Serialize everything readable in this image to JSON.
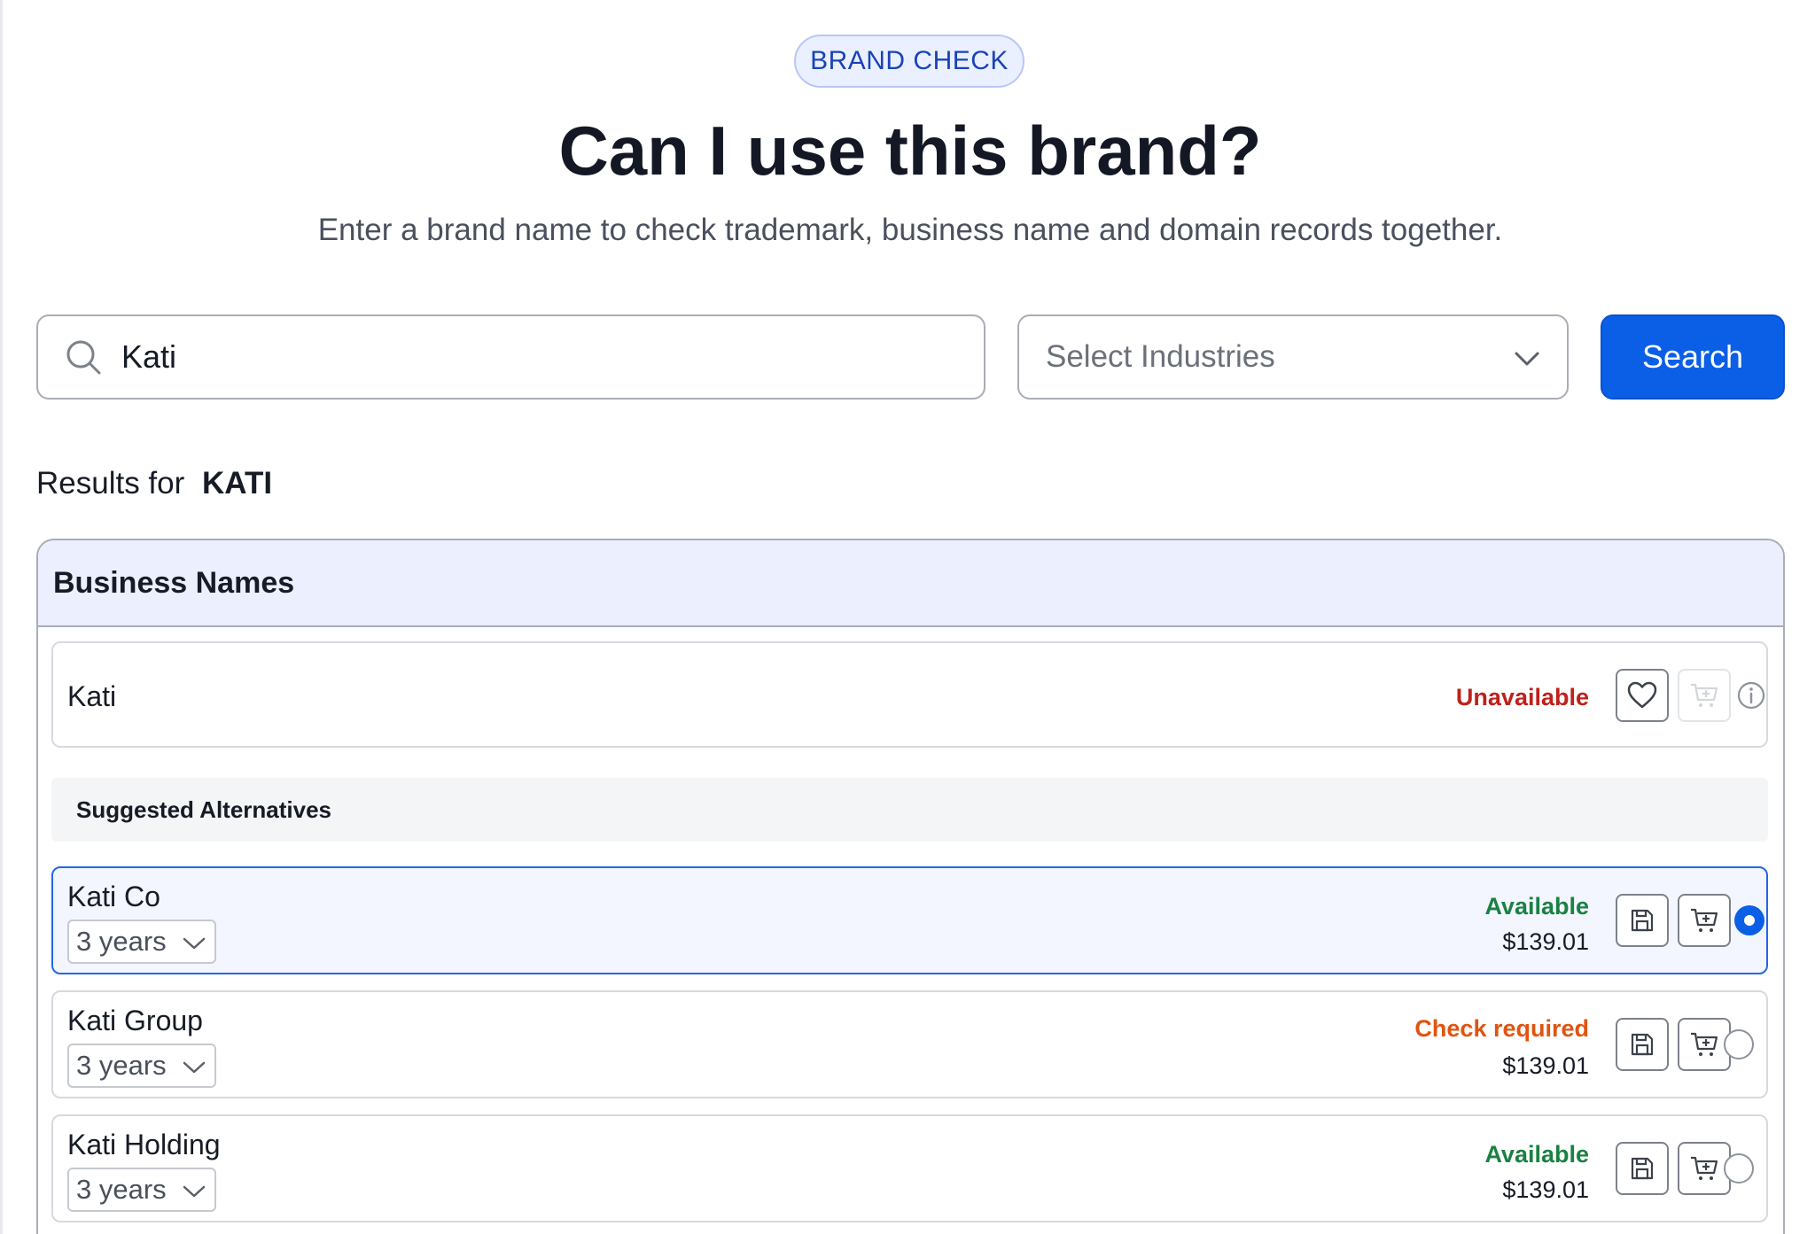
{
  "badge": "BRAND CHECK",
  "title": "Can I use this brand?",
  "subtitle": "Enter a brand name to check trademark, business name and domain records together.",
  "search": {
    "value": "Kati",
    "industries_placeholder": "Select Industries",
    "button_label": "Search"
  },
  "results": {
    "prefix": "Results for",
    "query": "KATI"
  },
  "panel": {
    "title": "Business Names",
    "primary": {
      "name": "Kati",
      "status": "Unavailable"
    },
    "alternatives_label": "Suggested Alternatives",
    "alternatives": [
      {
        "name": "Kati Co",
        "term": "3 years",
        "status": "Available",
        "price": "$139.01",
        "selected": true
      },
      {
        "name": "Kati Group",
        "term": "3 years",
        "status": "Check required",
        "price": "$139.01",
        "selected": false
      },
      {
        "name": "Kati Holding",
        "term": "3 years",
        "status": "Available",
        "price": "$139.01",
        "selected": false
      }
    ]
  },
  "colors": {
    "accent": "#0a5fe6",
    "unavailable": "#c0201b",
    "available": "#1a8142",
    "check_required": "#e0540f"
  },
  "icons": {
    "search": "search-icon",
    "dropdown": "chevron-down-icon",
    "favorite": "heart-icon",
    "cart": "cart-add-icon",
    "info": "info-icon",
    "save": "save-icon"
  }
}
